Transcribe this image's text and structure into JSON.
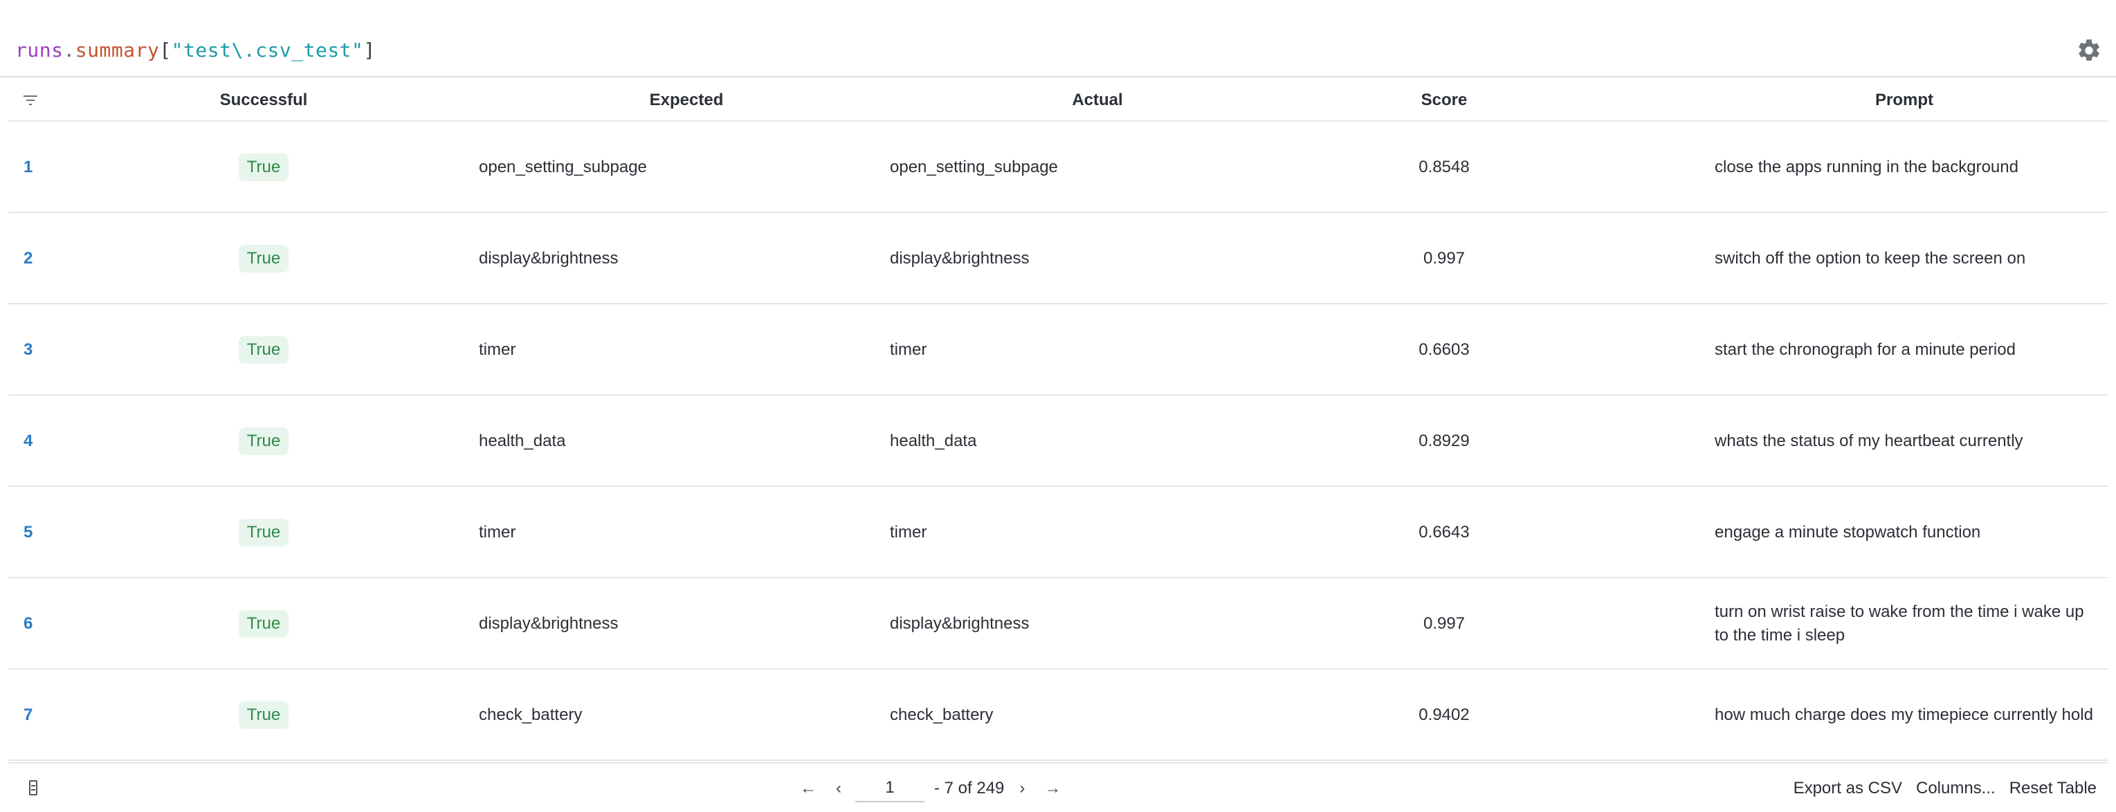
{
  "query": {
    "keyword": "runs",
    "dot": ".",
    "property": "summary",
    "open_bracket": "[",
    "string": "\"test\\.csv_test\"",
    "close_bracket": "]"
  },
  "table": {
    "columns": {
      "successful": "Successful",
      "expected": "Expected",
      "actual": "Actual",
      "score": "Score",
      "prompt": "Prompt"
    },
    "rows": [
      {
        "index": "1",
        "successful": "True",
        "expected": "open_setting_subpage",
        "actual": "open_setting_subpage",
        "score": "0.8548",
        "prompt": "close the apps running in the background"
      },
      {
        "index": "2",
        "successful": "True",
        "expected": "display&brightness",
        "actual": "display&brightness",
        "score": "0.997",
        "prompt": "switch off the option to keep the screen on"
      },
      {
        "index": "3",
        "successful": "True",
        "expected": "timer",
        "actual": "timer",
        "score": "0.6603",
        "prompt": "start the chronograph for a minute period"
      },
      {
        "index": "4",
        "successful": "True",
        "expected": "health_data",
        "actual": "health_data",
        "score": "0.8929",
        "prompt": "whats the status of my heartbeat currently"
      },
      {
        "index": "5",
        "successful": "True",
        "expected": "timer",
        "actual": "timer",
        "score": "0.6643",
        "prompt": "engage a minute stopwatch function"
      },
      {
        "index": "6",
        "successful": "True",
        "expected": "display&brightness",
        "actual": "display&brightness",
        "score": "0.997",
        "prompt": "turn on wrist raise to wake from the time i wake up to the time i sleep"
      },
      {
        "index": "7",
        "successful": "True",
        "expected": "check_battery",
        "actual": "check_battery",
        "score": "0.9402",
        "prompt": "how much charge does my timepiece currently hold"
      }
    ]
  },
  "pagination": {
    "first": "←",
    "prev": "‹",
    "page_value": "1",
    "range_text": "- 7 of 249",
    "next": "›",
    "last": "→"
  },
  "actions": {
    "export": "Export as CSV",
    "columns": "Columns...",
    "reset": "Reset Table"
  },
  "colors": {
    "keyword": "#9a3fc5",
    "property": "#c2552e",
    "string": "#1f9ba6",
    "index_link": "#2b7cc4",
    "true_badge_bg": "#e8f5ec",
    "true_badge_text": "#2f8a4a"
  },
  "icons": [
    "filter-icon",
    "gear-icon",
    "columns-icon"
  ]
}
